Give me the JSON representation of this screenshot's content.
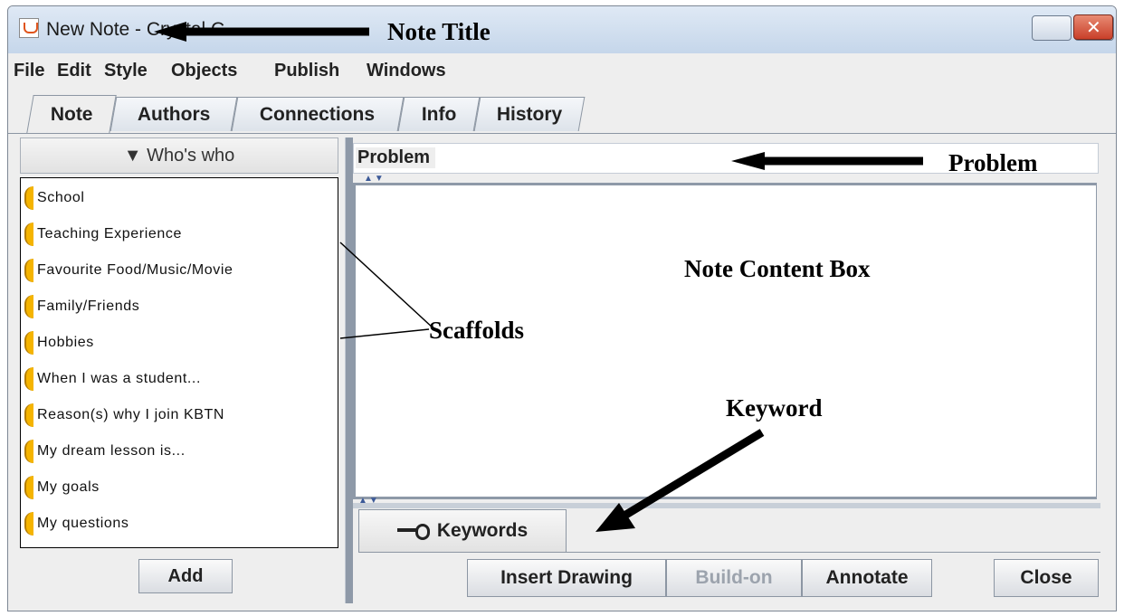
{
  "window": {
    "title": "New Note - Crystal C.",
    "controls": {
      "minimize": "minimize",
      "maximize": "maximize",
      "close": "close"
    }
  },
  "menu": [
    "File",
    "Edit",
    "Style",
    "Objects",
    "Publish",
    "Windows"
  ],
  "tabs": [
    {
      "label": "Note",
      "active": true
    },
    {
      "label": "Authors",
      "active": false
    },
    {
      "label": "Connections",
      "active": false
    },
    {
      "label": "Info",
      "active": false
    },
    {
      "label": "History",
      "active": false
    }
  ],
  "sidebar": {
    "header": "▼ Who's who",
    "items": [
      "School",
      "Teaching Experience",
      "Favourite Food/Music/Movie",
      "Family/Friends",
      "Hobbies",
      "When I was a student...",
      "Reason(s) why I join KBTN",
      "My dream lesson is...",
      "My goals",
      "My questions"
    ],
    "add_label": "Add"
  },
  "main": {
    "problem_label": "Problem",
    "keywords_label": "Keywords",
    "buttons": {
      "insert_drawing": "Insert Drawing",
      "build_on": "Build-on",
      "annotate": "Annotate",
      "close": "Close"
    }
  },
  "annotations": {
    "note_title": "Note Title",
    "problem": "Problem",
    "content_box": "Note Content Box",
    "scaffolds": "Scaffolds",
    "keyword": "Keyword"
  },
  "colors": {
    "scaffold_accent": "#f5b400",
    "close_button": "#c9402a"
  }
}
